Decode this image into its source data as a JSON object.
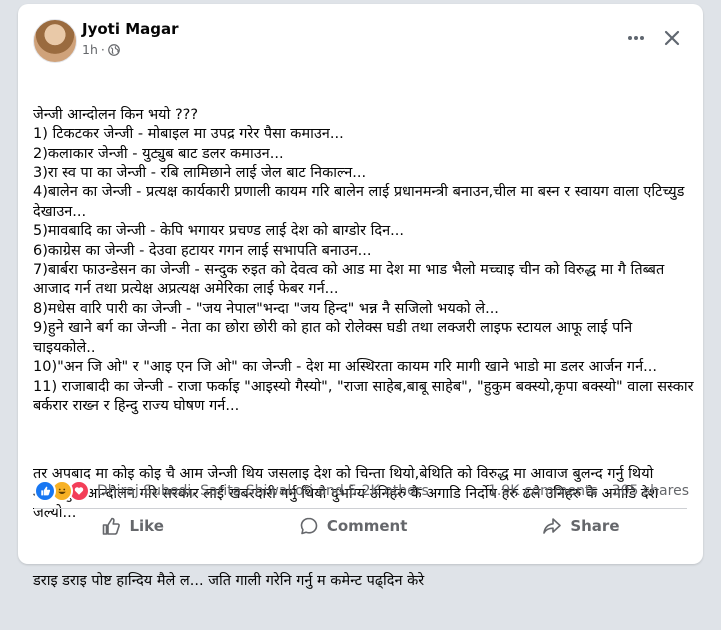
{
  "post": {
    "author": "Jyoti Magar",
    "time": "1h",
    "dot": "·",
    "paragraphs": [
      "जेन्जी आन्दोलन किन भयो ???\n1) टिकटकर जेन्जी - मोबाइल मा उपद्र गरेर पैसा कमाउन...\n2)कलाकार जेन्जी - युट्युब बाट डलर कमाउन...\n3)रा स्व पा का जेन्जी - रबि लामिछाने लाई जेल बाट निकाल्न...\n4)बालेन का जेन्जी - प्रत्यक्ष कार्यकारी प्रणाली कायम गरि बालेन लाई प्रधानमन्त्री बनाउन,चील मा बस्न र स्वायग वाला एटिच्युड देखाउन...\n5)मावबादि का जेन्जी - केपि भगायर प्रचण्ड लाई देश को बाग्डोर दिन...\n6)काग्रेस का जेन्जी - देउवा हटायर गगन लाई सभापति बनाउन...\n7)बार्बरा फाउन्डेसन का जेन्जी - सन्दुक रुइत को देवत्व को आड मा देश मा भाड भैलो मच्चाइ चीन को विरुद्ध मा गै तिब्बत आजाद गर्न तथा प्रत्येक्ष अप्रत्यक्ष अमेरिका लाई फेबर गर्न...\n8)मधेस वारि पारी का जेन्जी - \"जय नेपाल\"भन्दा \"जय हिन्द\" भन्न नै सजिलो भयको ले...\n9)हुने खाने बर्ग का जेन्जी - नेता का छोरा छोरी को हात को रोलेक्स घडी तथा लक्जरी लाइफ स्टायल आफू लाई पनि चाइयकोले..\n10)\"अन जि ओ\" र \"आइ एन जि ओ\" का जेन्जी - देश मा अस्थिरता कायम गरि मागी खाने भाडो मा डलर आर्जन गर्न...\n11) राजाबादी का जेन्जी - राजा फर्काइ \"आइस्यो गैस्यो\", \"राजा साहेब,बाबू साहेब\", \"हुकुम बक्स्यो,कृपा बक्स्यो\" वाला सस्कार बर्करार राख्न र हिन्दु राज्य घोषण गर्न...",
      "तर अपबाद मा कोइ कोइ चै आम जेन्जी थिय जसलाइ देश को चिन्ता थियो,बेथिति को विरुद्ध मा आवाज बुलन्द गर्नु थियो शान्तिपुर्ण आन्दोलन गरि सरकार लाई खबरदारी गर्नु थियो दुर्भाग्य उनिहरु कै अगाडि निर्दोष हरु ढले उनिहरु कै अगाडि देश जल्यो...",
      "डराइ डराइ पोष्ट हान्दिय मैले ल... जति गाली गरेनि गर्नु म कमेन्ट पढ्दिन केरे"
    ]
  },
  "reactions": {
    "icons": [
      "like-icon",
      "haha-icon",
      "love-icon"
    ],
    "names": "Dhiraj Subedi, Sarita Shiwakoti and 5.2K others",
    "comments": "1.9K comments",
    "shares": "305 shares"
  },
  "actions": {
    "like": "Like",
    "comment": "Comment",
    "share": "Share"
  },
  "colors": {
    "background": "#dfe3e8",
    "card": "#ffffff",
    "secondary_text": "#65676b",
    "like_blue": "#1877f2"
  }
}
